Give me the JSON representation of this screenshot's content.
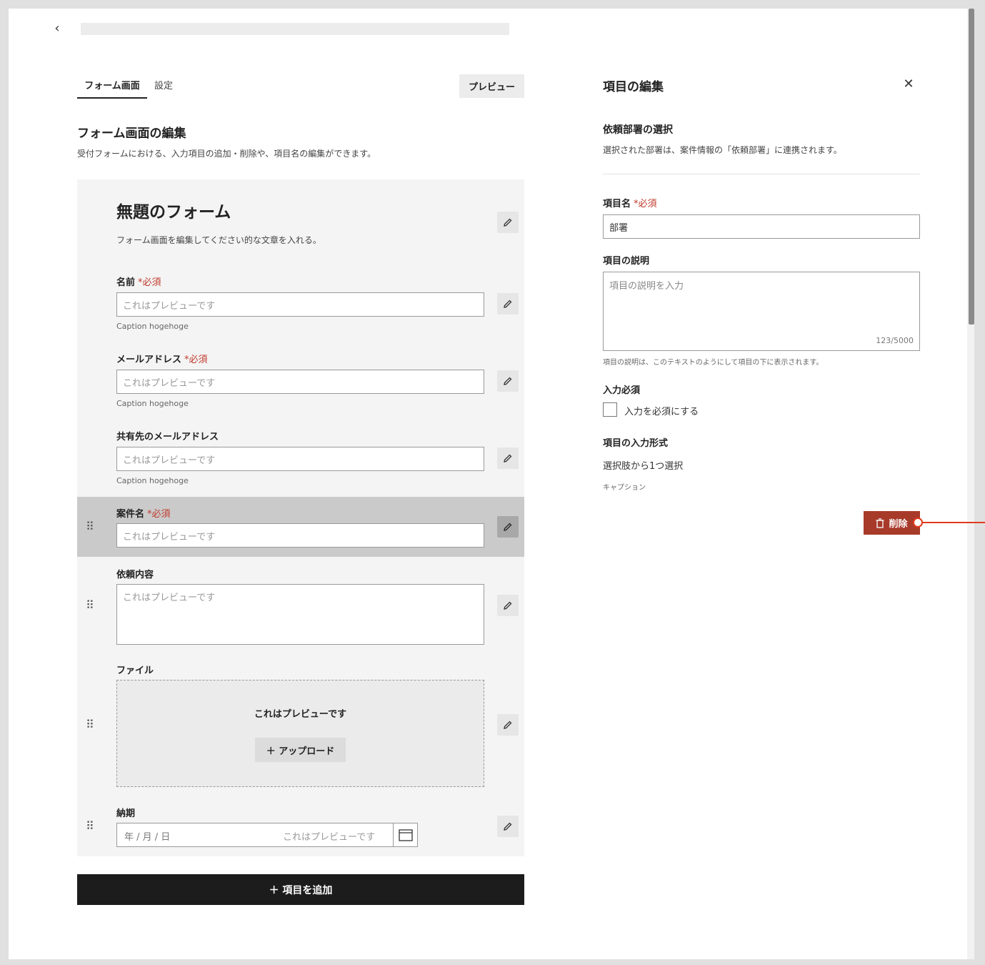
{
  "header": {
    "back_icon": "chevron-left-icon",
    "title_placeholder_bar": ""
  },
  "tabs": [
    {
      "label": "フォーム画面",
      "active": true
    },
    {
      "label": "設定",
      "active": false
    }
  ],
  "preview_button": "プレビュー",
  "section": {
    "title": "フォーム画面の編集",
    "description": "受付フォームにおける、入力項目の追加・削除や、項目名の編集ができます。"
  },
  "form": {
    "title": "無題のフォーム",
    "description": "フォーム画面を編集してください的な文章を入れる。",
    "fields": [
      {
        "label": "名前",
        "required": "*必須",
        "placeholder": "これはプレビューです",
        "caption": "Caption hogehoge"
      },
      {
        "label": "メールアドレス",
        "required": "*必須",
        "placeholder": "これはプレビューです",
        "caption": "Caption hogehoge"
      },
      {
        "label": "共有先のメールアドレス",
        "required": "",
        "placeholder": "これはプレビューです",
        "caption": "Caption hogehoge"
      },
      {
        "label": "案件名",
        "required": "*必須",
        "placeholder": "これはプレビューです",
        "caption": ""
      },
      {
        "label": "依頼内容",
        "required": "",
        "placeholder": "これはプレビューです",
        "caption": ""
      },
      {
        "label": "ファイル",
        "required": "",
        "placeholder": "これはプレビューです",
        "upload_label": "＋ アップロード"
      },
      {
        "label": "納期",
        "required": "",
        "date_placeholder": "年 / 月 / 日",
        "placeholder": "これはプレビューです"
      }
    ],
    "add_button": "＋ 項目を追加"
  },
  "edit_panel": {
    "title": "項目の編集",
    "close_icon": "close-icon",
    "subtitle": "依頼部署の選択",
    "subtitle_desc": "選択された部署は、案件情報の「依頼部署」に連携されます。",
    "name_label": "項目名",
    "name_required": "*必須",
    "name_value": "部署",
    "desc_label": "項目の説明",
    "desc_placeholder": "項目の説明を入力",
    "desc_count": "123/5000",
    "desc_help": "項目の説明は、このテキストのようにして項目の下に表示されます。",
    "required_label": "入力必須",
    "required_checkbox_label": "入力を必須にする",
    "required_checked": false,
    "input_type_label": "項目の入力形式",
    "input_type_value": "選択肢から1つ選択",
    "input_type_caption": "キャプション",
    "delete_button": "削除"
  },
  "colors": {
    "accent_dark": "#1c1c1c",
    "danger": "#a83a2a",
    "required": "#c0392b",
    "annotation": "#e03a1e"
  }
}
